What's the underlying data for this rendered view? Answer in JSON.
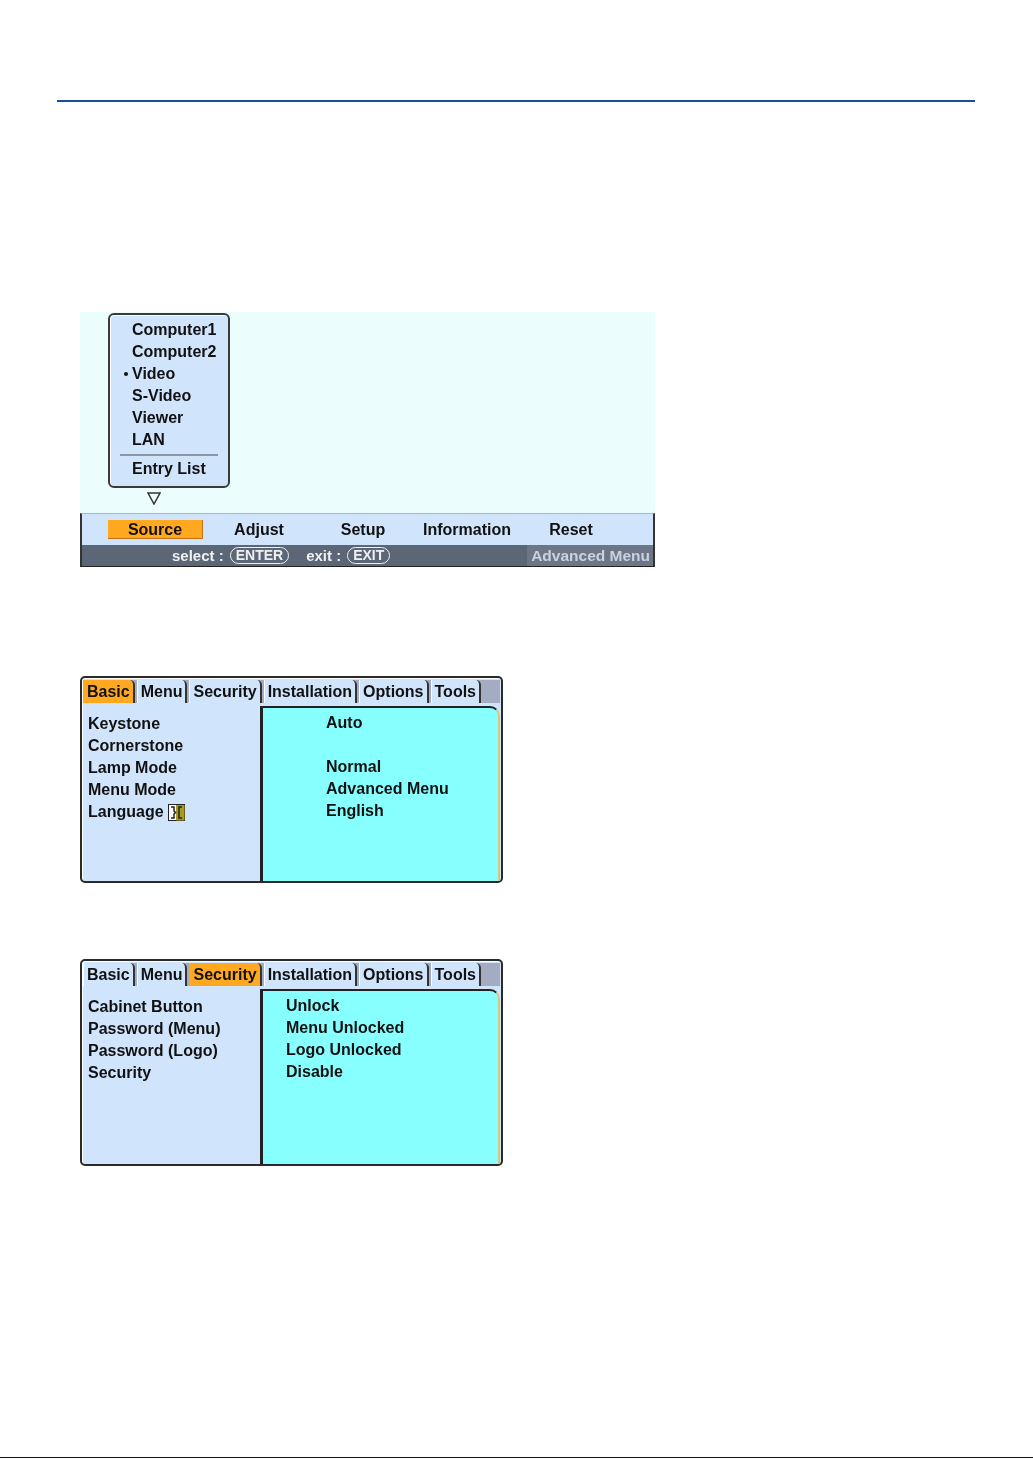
{
  "source_screen": {
    "dropdown": {
      "items": [
        {
          "label": "Computer1",
          "selected": false
        },
        {
          "label": "Computer2",
          "selected": false
        },
        {
          "label": "Video",
          "selected": true
        },
        {
          "label": "S-Video",
          "selected": false
        },
        {
          "label": "Viewer",
          "selected": false
        },
        {
          "label": "LAN",
          "selected": false
        }
      ],
      "entry_item": "Entry List"
    },
    "menu_bar": [
      {
        "label": "Source",
        "selected": true
      },
      {
        "label": "Adjust",
        "selected": false
      },
      {
        "label": "Setup",
        "selected": false
      },
      {
        "label": "Information",
        "selected": false
      },
      {
        "label": "Reset",
        "selected": false
      }
    ],
    "status_bar": {
      "hints": [
        {
          "label": "select :",
          "key": "ENTER"
        },
        {
          "label": "exit :",
          "key": "EXIT"
        }
      ],
      "menu_mode": "Advanced Menu"
    }
  },
  "settings_screens": [
    {
      "tabs": [
        {
          "label": "Basic",
          "selected": true
        },
        {
          "label": "Menu",
          "selected": false
        },
        {
          "label": "Security",
          "selected": false
        },
        {
          "label": "Installation",
          "selected": false
        },
        {
          "label": "Options",
          "selected": false
        },
        {
          "label": "Tools",
          "selected": false
        }
      ],
      "rows": [
        {
          "label": "Keystone",
          "value": "Auto",
          "kind": "plain"
        },
        {
          "label": "Cornerstone",
          "kind": "plain"
        },
        {
          "label": "Lamp Mode",
          "value": "Normal",
          "kind": "plain"
        },
        {
          "label": "Menu Mode",
          "value": "Advanced Menu",
          "kind": "plain"
        },
        {
          "label": "Language",
          "value": "English",
          "kind": "with_icon"
        }
      ]
    },
    {
      "tabs": [
        {
          "label": "Basic",
          "selected": false
        },
        {
          "label": "Menu",
          "selected": false
        },
        {
          "label": "Security",
          "selected": true
        },
        {
          "label": "Installation",
          "selected": false
        },
        {
          "label": "Options",
          "selected": false
        },
        {
          "label": "Tools",
          "selected": false
        }
      ],
      "rows": [
        {
          "label": "Cabinet Button",
          "value": "Unlock",
          "kind": "plain"
        },
        {
          "label": "Password (Menu)",
          "value": "Menu Unlocked",
          "kind": "plain"
        },
        {
          "label": "Password (Logo)",
          "value": "Logo Unlocked",
          "kind": "plain"
        },
        {
          "label": "Security",
          "value": "Disable",
          "kind": "plain"
        }
      ]
    }
  ]
}
